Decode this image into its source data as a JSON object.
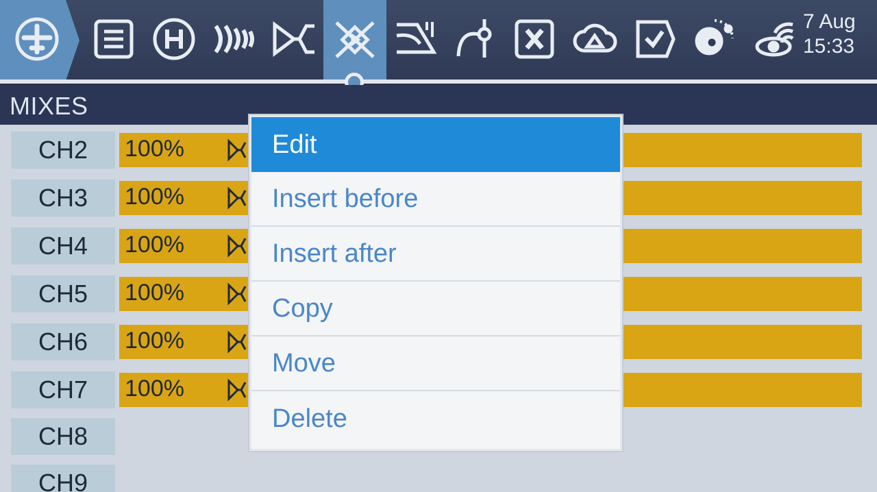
{
  "topbar": {
    "icons": [
      {
        "name": "model-plane-icon"
      },
      {
        "name": "model-setup-icon"
      },
      {
        "name": "heli-icon"
      },
      {
        "name": "flight-modes-icon"
      },
      {
        "name": "inputs-icon"
      },
      {
        "name": "mixes-icon"
      },
      {
        "name": "outputs-icon"
      },
      {
        "name": "curves-icon"
      },
      {
        "name": "logical-switches-icon"
      },
      {
        "name": "special-functions-icon"
      },
      {
        "name": "checklist-icon"
      },
      {
        "name": "telemetry-icon"
      },
      {
        "name": "telemetry-sensors-icon"
      }
    ],
    "date": "7 Aug",
    "time": "15:33"
  },
  "page": {
    "title": "MIXES"
  },
  "mixes": {
    "rows": [
      {
        "channel": "CH2",
        "weight": "100%",
        "has_mix": true
      },
      {
        "channel": "CH3",
        "weight": "100%",
        "has_mix": true
      },
      {
        "channel": "CH4",
        "weight": "100%",
        "has_mix": true
      },
      {
        "channel": "CH5",
        "weight": "100%",
        "has_mix": true
      },
      {
        "channel": "CH6",
        "weight": "100%",
        "has_mix": true
      },
      {
        "channel": "CH7",
        "weight": "100%",
        "has_mix": true
      },
      {
        "channel": "CH8",
        "has_mix": false
      },
      {
        "channel": "CH9",
        "has_mix": false
      }
    ]
  },
  "context_menu": {
    "items": [
      "Edit",
      "Insert before",
      "Insert after",
      "Copy",
      "Move",
      "Delete"
    ],
    "selected": "Edit"
  },
  "colors": {
    "accent": "#5f8fbd",
    "menu_selected": "#1f8ad8",
    "menu_text": "#4a86c8",
    "mix_bar": "#d9a514",
    "channel_cell": "#b9ccd8"
  }
}
